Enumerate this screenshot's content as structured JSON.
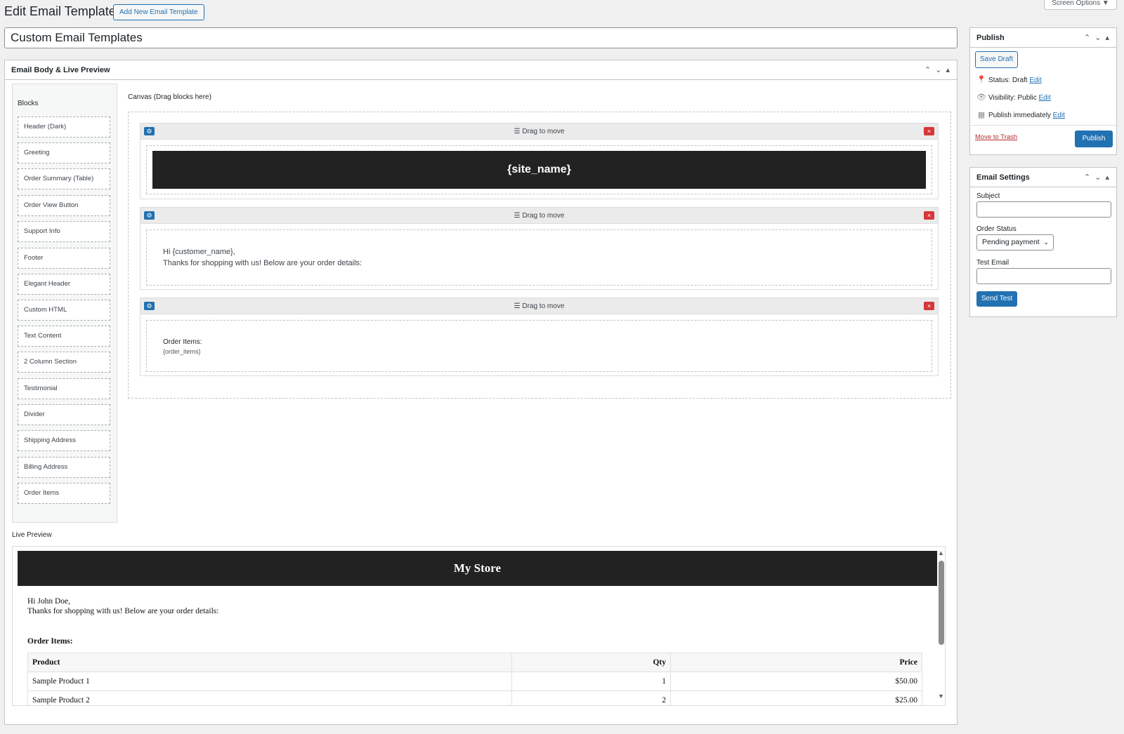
{
  "header": {
    "title": "Edit Email Template",
    "add_new_label": "Add New Email Template",
    "screen_options_label": "Screen Options ▼"
  },
  "post_title": "Custom Email Templates",
  "main_box": {
    "title": "Email Body & Live Preview",
    "blocks_title": "Blocks",
    "blocks": [
      "Header (Dark)",
      "Greeting",
      "Order Summary (Table)",
      "Order View Button",
      "Support Info",
      "Footer",
      "Elegant Header",
      "Custom HTML",
      "Text Content",
      "2 Column Section",
      "Testimonial",
      "Divider",
      "Shipping Address",
      "Billing Address",
      "Order Items"
    ],
    "canvas_label": "Canvas (Drag blocks here)",
    "drag_label": "☰ Drag to move",
    "canvas_blocks": {
      "header_text": "{site_name}",
      "greeting_line1": "Hi {customer_name},",
      "greeting_line2": "Thanks for shopping with us! Below are your order details:",
      "items_title": "Order Items:",
      "items_token": "{order_items}"
    },
    "live_preview_label": "Live Preview",
    "preview": {
      "store_name": "My Store",
      "greeting_line1": "Hi John Doe,",
      "greeting_line2": "Thanks for shopping with us! Below are your order details:",
      "items_title": "Order Items:",
      "table_headers": [
        "Product",
        "Qty",
        "Price"
      ],
      "rows": [
        [
          "Sample Product 1",
          "1",
          "$50.00"
        ],
        [
          "Sample Product 2",
          "2",
          "$25.00"
        ]
      ]
    }
  },
  "publish": {
    "title": "Publish",
    "save_draft": "Save Draft",
    "status_label": "Status: Draft",
    "visibility_label": "Visibility: Public",
    "publish_time_label": "Publish immediately",
    "edit_link": "Edit",
    "trash_link": "Move to Trash",
    "publish_button": "Publish"
  },
  "email_settings": {
    "title": "Email Settings",
    "subject_label": "Subject",
    "subject_value": "",
    "order_status_label": "Order Status",
    "order_status_value": "Pending payment",
    "test_email_label": "Test Email",
    "test_email_value": "",
    "send_test_label": "Send Test"
  },
  "colors": {
    "accent": "#2271b1",
    "danger": "#d63638",
    "header_dark": "#222222"
  }
}
